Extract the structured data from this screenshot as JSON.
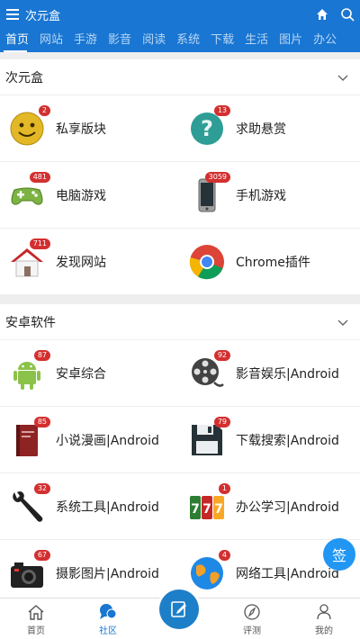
{
  "appbar": {
    "title": "次元盒"
  },
  "tabs": [
    "首页",
    "网站",
    "手游",
    "影音",
    "阅读",
    "系统",
    "下载",
    "生活",
    "图片",
    "办公"
  ],
  "sections": [
    {
      "title": "次元盒",
      "items": [
        {
          "label": "私享版块",
          "badge": "2",
          "icon": "smiley-icon"
        },
        {
          "label": "求助悬赏",
          "badge": "13",
          "icon": "question-icon"
        },
        {
          "label": "电脑游戏",
          "badge": "481",
          "icon": "gamepad-icon"
        },
        {
          "label": "手机游戏",
          "badge": "3059",
          "icon": "phone-icon"
        },
        {
          "label": "发现网站",
          "badge": "711",
          "icon": "house-icon"
        },
        {
          "label": "Chrome插件",
          "badge": "",
          "icon": "chrome-icon"
        }
      ]
    },
    {
      "title": "安卓软件",
      "items": [
        {
          "label": "安卓综合",
          "badge": "87",
          "icon": "android-icon"
        },
        {
          "label": "影音娱乐|Android",
          "badge": "92",
          "icon": "film-reel-icon"
        },
        {
          "label": "小说漫画|Android",
          "badge": "85",
          "icon": "book-icon"
        },
        {
          "label": "下载搜索|Android",
          "badge": "79",
          "icon": "floppy-icon"
        },
        {
          "label": "系统工具|Android",
          "badge": "32",
          "icon": "wrench-icon"
        },
        {
          "label": "办公学习|Android",
          "badge": "1",
          "icon": "slot-machine-icon"
        },
        {
          "label": "摄影图片|Android",
          "badge": "67",
          "icon": "camera-icon"
        },
        {
          "label": "网络工具|Android",
          "badge": "4",
          "icon": "globe-icon"
        }
      ]
    }
  ],
  "bottomnav": [
    {
      "label": "首页",
      "icon": "home-icon"
    },
    {
      "label": "社区",
      "icon": "chat-icon"
    },
    {
      "label": "",
      "icon": "edit-icon"
    },
    {
      "label": "评测",
      "icon": "compass-icon"
    },
    {
      "label": "我的",
      "icon": "user-icon"
    }
  ],
  "floating": {
    "sign_label": "签"
  },
  "colors": {
    "primary": "#1976d2",
    "badge": "#d32f2f"
  }
}
